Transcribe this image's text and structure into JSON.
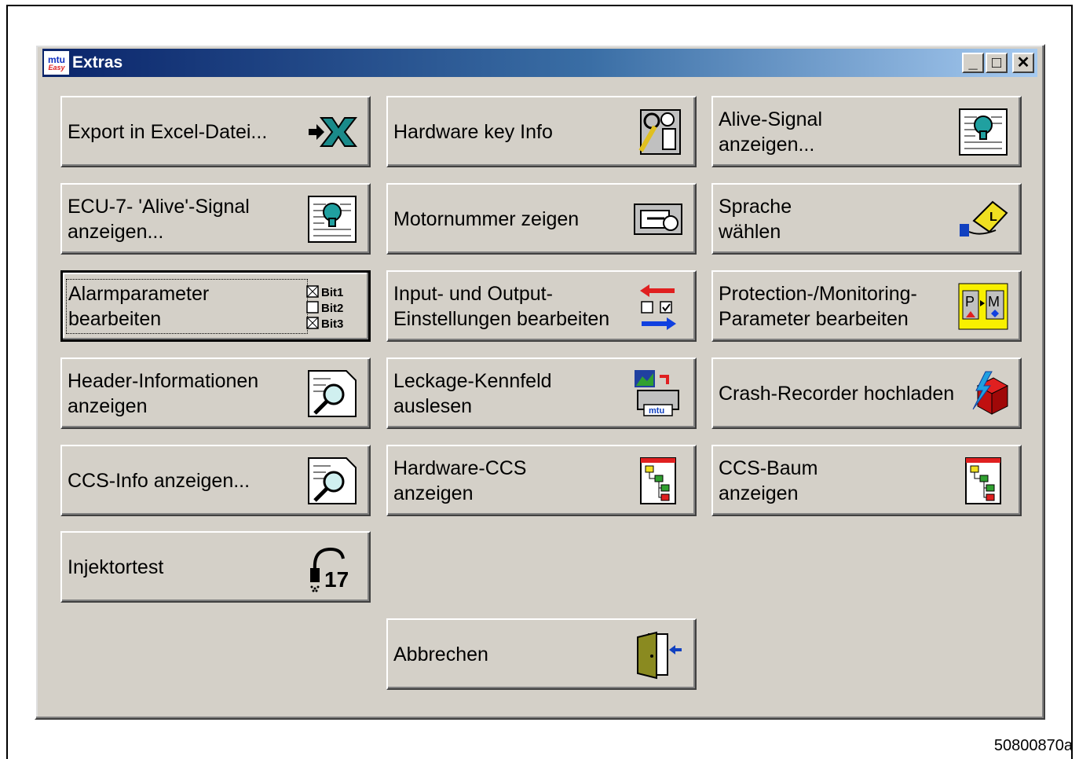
{
  "window": {
    "title": "Extras",
    "logo_text_top": "mtu",
    "logo_text_bottom": "Easy",
    "controls": {
      "minimize": "_",
      "maximize": "□",
      "close": "✕"
    }
  },
  "buttons": {
    "export_excel": "Export in Excel-Datei...",
    "hardware_key_info": "Hardware key Info",
    "alive_signal": "Alive-Signal\nanzeigen...",
    "ecu7_alive": "ECU-7- 'Alive'-Signal\nanzeigen...",
    "motornummer": "Motornummer zeigen",
    "sprache": "Sprache\nwählen",
    "alarmparameter": "Alarmparameter\nbearbeiten",
    "input_output": "Input- und Output-\nEinstellungen bearbeiten",
    "protection": "Protection-/Monitoring-\nParameter bearbeiten",
    "header_info": "Header-Informationen\nanzeigen",
    "leckage": "Leckage-Kennfeld\nauslesen",
    "crash_recorder": "Crash-Recorder hochladen",
    "ccs_info": "CCS-Info anzeigen...",
    "hardware_ccs": "Hardware-CCS\nanzeigen",
    "ccs_baum": "CCS-Baum\nanzeigen",
    "injektortest": "Injektortest",
    "abbrechen": "Abbrechen"
  },
  "icon_texts": {
    "bit1": "Bit1",
    "bit2": "Bit2",
    "bit3": "Bit3",
    "injektor_number": "17",
    "leckage_badge": "mtu",
    "pm_p": "P",
    "pm_m": "M"
  },
  "figure_id": "50800870a",
  "icons": {
    "export_excel": "excel-export-icon",
    "hardware_key_info": "tools-key-icon",
    "alive_signal": "alive-document-icon",
    "ecu7_alive": "alive-document-icon",
    "motornummer": "engine-number-icon",
    "sprache": "language-book-icon",
    "alarmparameter": "checkbox-bits-icon",
    "input_output": "input-output-arrows-icon",
    "protection": "protection-monitoring-icon",
    "header_info": "document-magnifier-icon",
    "leckage": "leckage-map-icon",
    "crash_recorder": "crash-recorder-icon",
    "ccs_info": "document-magnifier-icon",
    "hardware_ccs": "tree-diagram-icon",
    "ccs_baum": "tree-diagram-icon",
    "injektortest": "injector-icon",
    "abbrechen": "exit-door-icon"
  },
  "colors": {
    "titlebar_start": "#0a246a",
    "titlebar_end": "#a6caf0",
    "face": "#d4d0c8"
  }
}
